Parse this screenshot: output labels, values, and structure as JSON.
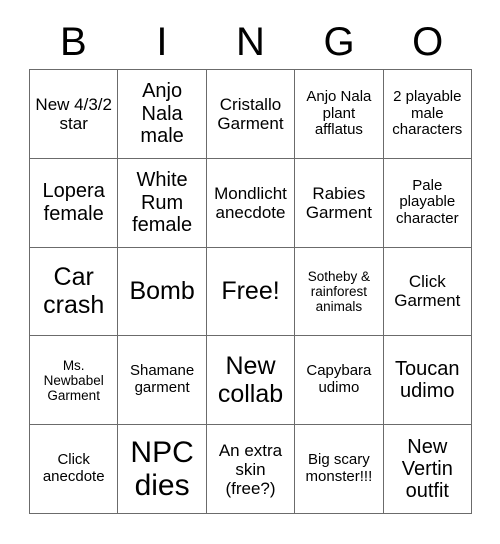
{
  "card": {
    "header": {
      "letters": [
        "B",
        "I",
        "N",
        "G",
        "O"
      ]
    },
    "colors": {
      "background": "#ffffff",
      "border": "#6b6b6b",
      "text": "#000000"
    },
    "grid": {
      "rows": 5,
      "columns": 5,
      "cells": [
        {
          "text": "New 4/3/2 star",
          "size": "m",
          "row": 1,
          "col": 1
        },
        {
          "text": "Anjo Nala male",
          "size": "l",
          "row": 1,
          "col": 2
        },
        {
          "text": "Cristallo Garment",
          "size": "m",
          "row": 1,
          "col": 3
        },
        {
          "text": "Anjo Nala plant afflatus",
          "size": "s",
          "row": 1,
          "col": 4
        },
        {
          "text": "2 playable male characters",
          "size": "s",
          "row": 1,
          "col": 5
        },
        {
          "text": "Lopera female",
          "size": "l",
          "row": 2,
          "col": 1
        },
        {
          "text": "White Rum female",
          "size": "l",
          "row": 2,
          "col": 2
        },
        {
          "text": "Mondlicht anecdote",
          "size": "m",
          "row": 2,
          "col": 3
        },
        {
          "text": "Rabies Garment",
          "size": "m",
          "row": 2,
          "col": 4
        },
        {
          "text": "Pale playable character",
          "size": "s",
          "row": 2,
          "col": 5
        },
        {
          "text": "Car crash",
          "size": "xl",
          "row": 3,
          "col": 1
        },
        {
          "text": "Bomb",
          "size": "xl",
          "row": 3,
          "col": 2
        },
        {
          "text": "Free!",
          "size": "xl",
          "row": 3,
          "col": 3
        },
        {
          "text": "Sotheby & rainforest animals",
          "size": "xs",
          "row": 3,
          "col": 4
        },
        {
          "text": "Click Garment",
          "size": "m",
          "row": 3,
          "col": 5
        },
        {
          "text": "Ms. Newbabel Garment",
          "size": "xs",
          "row": 4,
          "col": 1
        },
        {
          "text": "Shamane garment",
          "size": "s",
          "row": 4,
          "col": 2
        },
        {
          "text": "New collab",
          "size": "xl",
          "row": 4,
          "col": 3
        },
        {
          "text": "Capybara udimo",
          "size": "s",
          "row": 4,
          "col": 4
        },
        {
          "text": "Toucan udimo",
          "size": "l",
          "row": 4,
          "col": 5
        },
        {
          "text": "Click anecdote",
          "size": "s",
          "row": 5,
          "col": 1
        },
        {
          "text": "NPC dies",
          "size": "xxl",
          "row": 5,
          "col": 2
        },
        {
          "text": "An extra skin (free?)",
          "size": "m",
          "row": 5,
          "col": 3
        },
        {
          "text": "Big scary monster!!!",
          "size": "s",
          "row": 5,
          "col": 4
        },
        {
          "text": "New Vertin outfit",
          "size": "l",
          "row": 5,
          "col": 5
        }
      ]
    }
  }
}
